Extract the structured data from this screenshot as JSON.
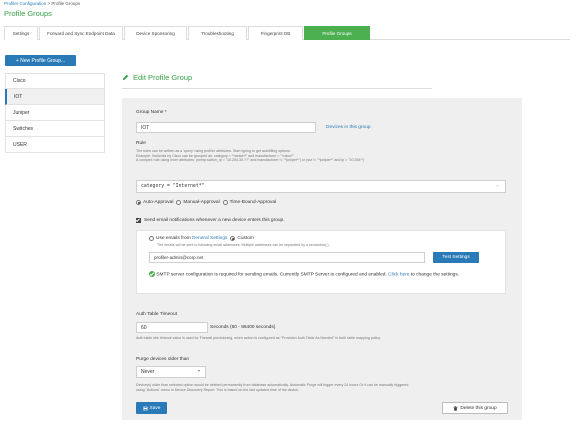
{
  "breadcrumb": {
    "root": "Profiler Configuration",
    "sep": " > ",
    "current": "Profile Groups"
  },
  "page_title": "Profile Groups",
  "tabs": [
    {
      "label": "Settings"
    },
    {
      "label": "Forward and Sync Endpoint Data"
    },
    {
      "label": "Device Sponsoring"
    },
    {
      "label": "Troubleshooting"
    },
    {
      "label": "Fingerprint DB"
    },
    {
      "label": "Profile Groups",
      "active": true
    }
  ],
  "new_group_button": "+ New Profile Group...",
  "sidebar": {
    "items": [
      "Cisco",
      "IOT",
      "Juniper",
      "Switches",
      "USER"
    ],
    "active": "IOT"
  },
  "edit": {
    "title": "Edit Profile Group",
    "group_name_label": "Group Name *",
    "group_name_value": "IOT",
    "devices_link": "Devices in this group",
    "rule_label": "Rule",
    "rule_hint_1": "The rules can be written as a 'query' using profiler attributes. Start typing to get autofilling options.",
    "rule_hint_2": "Example: Switches by Cisco can be grouped as: category = \"*switch*\" and manufacturer = \"*cisco*\"",
    "rule_hint_3": "A complex rule using inner attributes: (snmp.switch_ip = \"10.254.30.??\" and manufacturer != \"*juniper*\") or (ssr != \"*juniper*\" and ip = \"10.254*\")",
    "rule_value": "category = \"Internet*\"",
    "approval": [
      {
        "label": "Auto-Approval",
        "checked": true
      },
      {
        "label": "Manual-Approval",
        "checked": false
      },
      {
        "label": "Time-Bound-Approval",
        "checked": false
      }
    ],
    "email_notify_label": "Send email notifications whenever a new device enters this group.",
    "use_emails_label": "Use emails from",
    "general_settings_link": "General Settings",
    "custom_label": "Custom",
    "email_hint": "The emails will be sent to following email addresses. Multiple addresses can be separated by a semicolon(;).",
    "email_value": "profiler-admin@corp.net",
    "test_settings_button": "Test Settings",
    "smtp_text": "SMTP server configuration is required for sending emails. Currently SMTP Server is configured and enabled.",
    "click_here": "Click here",
    "smtp_text_tail": "to change the settings.",
    "auth_timeout_label": "Auth Table Timeout",
    "auth_timeout_value": "60",
    "auth_timeout_unit": "Seconds (60 - 86400 seconds)",
    "auth_timeout_hint": "Auth table idle timeout value is used for Firewall provisioning, when action is configured as \"Provision Auth Table As Needed\" in Auth table mapping policy.",
    "purge_label": "Purge devices older than",
    "purge_value": "Never",
    "purge_hint_1": "Device(s) older than selected option would be deleted permanently from database automatically. Automatic Purge will trigger every 24 hours Or it can be manually triggered",
    "purge_hint_2": "using \"Actions\" menu in Device Discovery Report. This is based on the last updated time of the device.",
    "save_button": "Save",
    "delete_button": "Delete this group"
  },
  "colors": {
    "brand_green": "#3aa04a",
    "active_tab": "#4caf50",
    "primary_blue": "#2a7ab8"
  }
}
